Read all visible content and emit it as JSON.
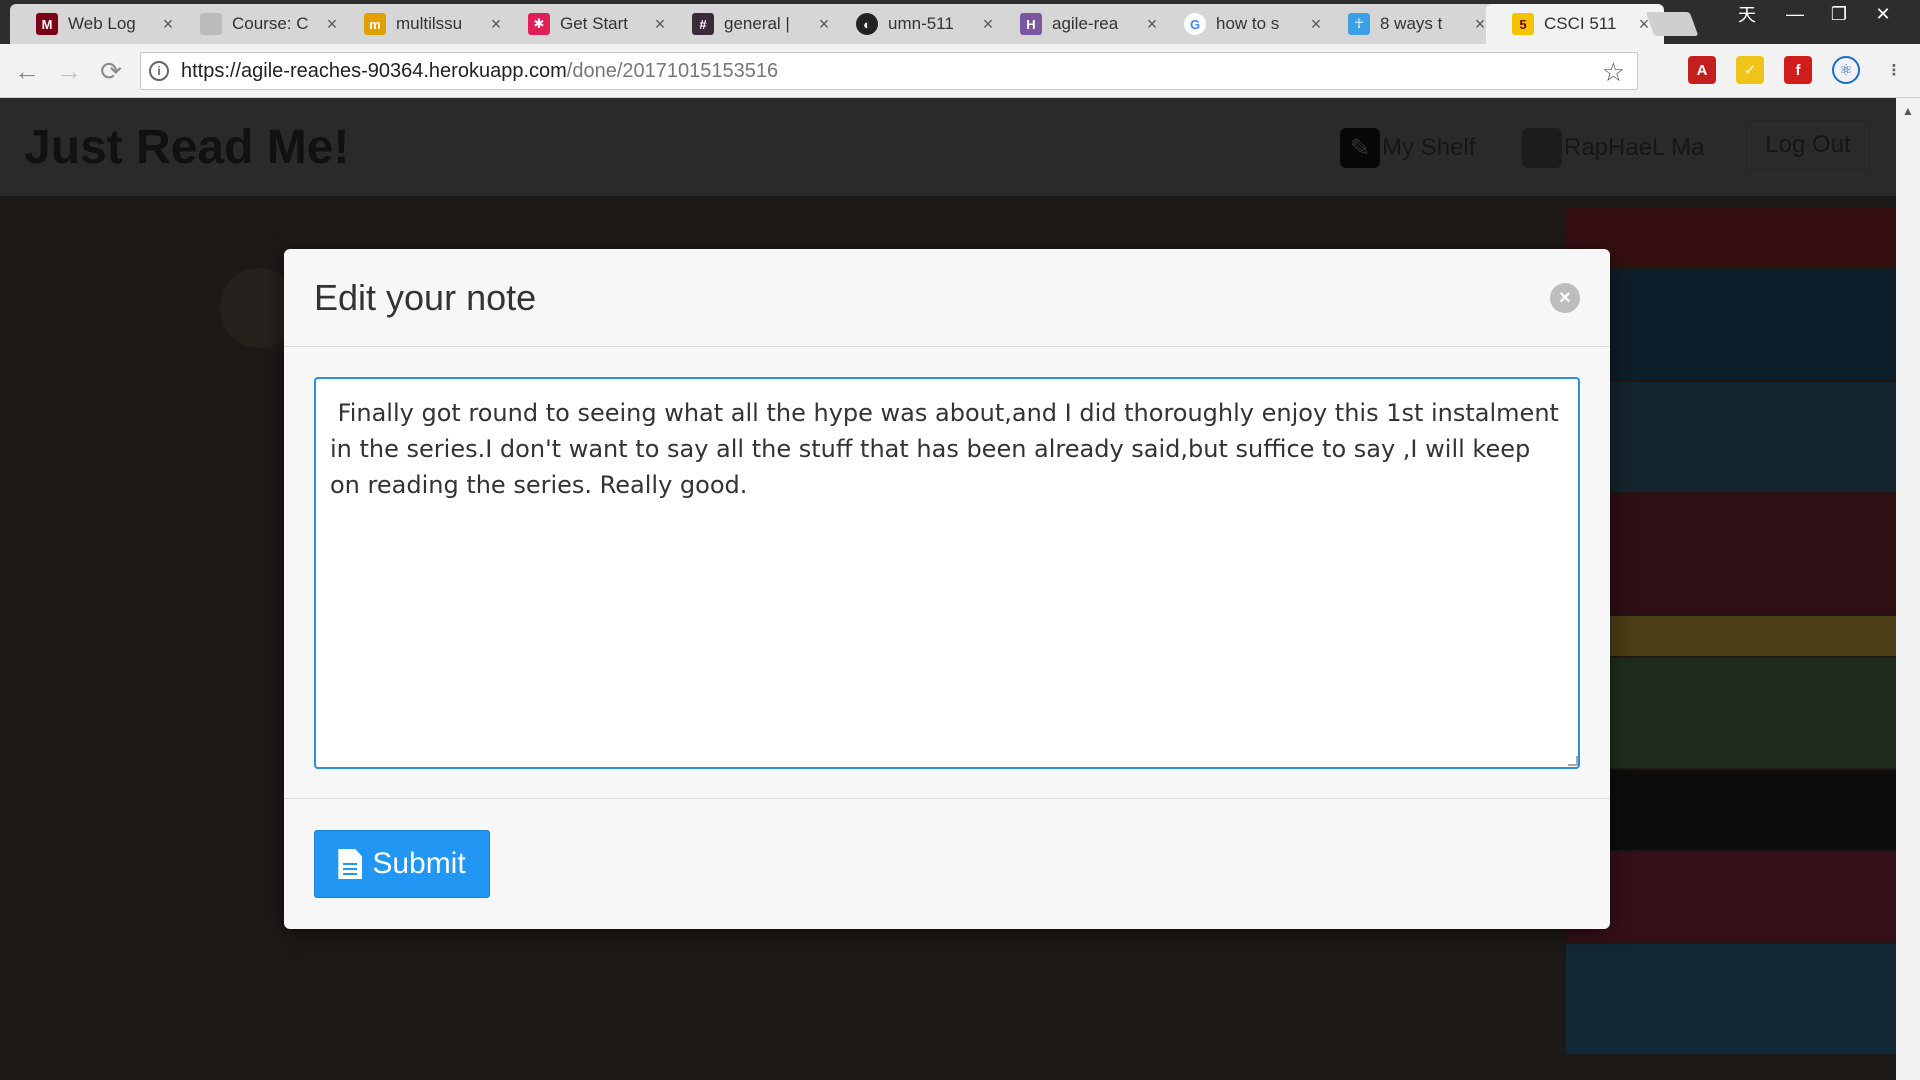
{
  "browser": {
    "tabs": [
      {
        "title": "Web Log",
        "favicon": "umn-icon",
        "color": "#7a0019"
      },
      {
        "title": "Course: C",
        "favicon": "page-icon",
        "color": "#888888"
      },
      {
        "title": "multilssu",
        "favicon": "mturk-icon",
        "color": "#e0a100"
      },
      {
        "title": "Get Start",
        "favicon": "slack-icon",
        "color": "#e01e5a"
      },
      {
        "title": "general |",
        "favicon": "hash-icon",
        "color": "#3a2a3a"
      },
      {
        "title": "umn-511",
        "favicon": "github-icon",
        "color": "#222222"
      },
      {
        "title": "agile-rea",
        "favicon": "heroku-icon",
        "color": "#79589f"
      },
      {
        "title": "how to s",
        "favicon": "google-icon",
        "color": "#4285f4"
      },
      {
        "title": "8 ways t",
        "favicon": "figure-icon",
        "color": "#3ba0e6"
      },
      {
        "title": "CSCI 511",
        "favicon": "csci-icon",
        "color": "#f5c400"
      }
    ],
    "url": {
      "host": "https://agile-reaches-90364.herokuapp.com",
      "path": "/done/20171015153516"
    },
    "window_controls": {
      "ime": "天",
      "minimize": "—",
      "restore": "❐",
      "close": "✕"
    },
    "nav": {
      "back": "←",
      "forward": "→",
      "reload": "⟳"
    }
  },
  "site": {
    "brand": "Just Read Me!",
    "nav": {
      "shelf": "My Shelf",
      "user": "RapHaeL Ma",
      "logout": "Log Out"
    }
  },
  "modal": {
    "title": "Edit your note",
    "note": " Finally got round to seeing what all the hype was about,and I did thoroughly enjoy this 1st instalment in the series.I don't want to say all the stuff that has been already said,but suffice to say ,I will keep on reading the series. Really good.",
    "submit": "Submit"
  },
  "colors": {
    "accent": "#2196f3",
    "focus_border": "#2e8fd6"
  }
}
